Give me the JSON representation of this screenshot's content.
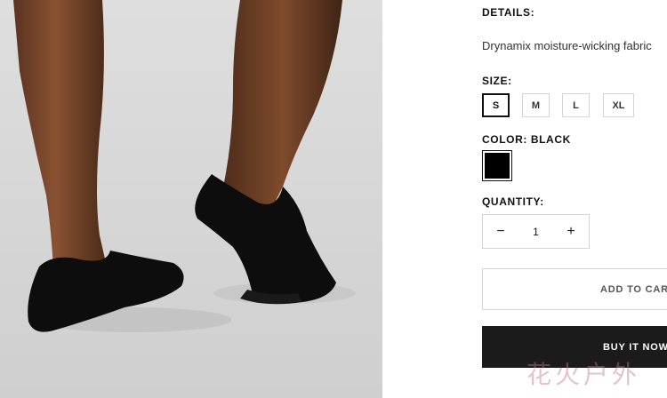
{
  "product": {
    "details_label": "DETAILS:",
    "details_text": "Drynamix moisture-wicking fabric",
    "size_label": "SIZE:",
    "sizes": [
      "S",
      "M",
      "L",
      "XL"
    ],
    "selected_size": "S",
    "color_label": "COLOR: BLACK",
    "color_swatch": "#000000",
    "quantity_label": "QUANTITY:",
    "quantity": "1",
    "minus_symbol": "−",
    "plus_symbol": "+",
    "add_to_cart": "ADD TO CART",
    "buy_now": "BUY IT NOW"
  },
  "watermark": "花火户外",
  "colors": {
    "accent_dark": "#1b1b1b",
    "border": "#d5d5d5"
  }
}
